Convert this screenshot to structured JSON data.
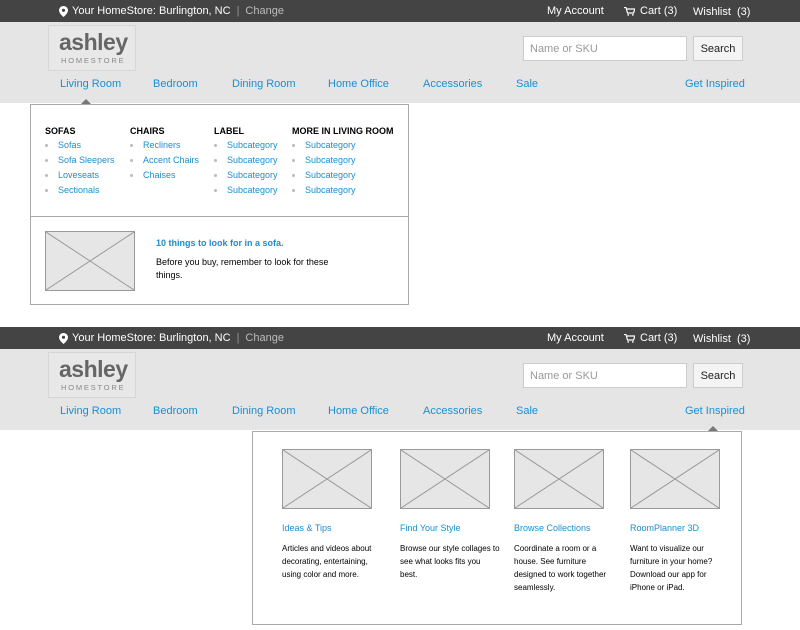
{
  "topbar": {
    "store_label": "Your HomeStore: Burlington, NC",
    "separator": "|",
    "change_label": "Change",
    "my_account": "My Account",
    "cart": "Cart (3)",
    "wishlist": "Wishlist  (3)"
  },
  "logo": {
    "name": "ashley",
    "sub": "HOMESTORE"
  },
  "search": {
    "placeholder": "Name or SKU",
    "button": "Search"
  },
  "nav": {
    "items": [
      "Living Room",
      "Bedroom",
      "Dining Room",
      "Home Office",
      "Accessories",
      "Sale",
      "Get Inspired"
    ]
  },
  "living_room_menu": {
    "columns": [
      {
        "heading": "SOFAS",
        "items": [
          "Sofas",
          "Sofa Sleepers",
          "Loveseats",
          "Sectionals"
        ]
      },
      {
        "heading": "CHAIRS",
        "items": [
          "Recliners",
          "Accent Chairs",
          "Chaises"
        ]
      },
      {
        "heading": "LABEL",
        "items": [
          "Subcategory",
          "Subcategory",
          "Subcategory",
          "Subcategory"
        ]
      },
      {
        "heading": "MORE IN LIVING ROOM",
        "items": [
          "Subcategory",
          "Subcategory",
          "Subcategory",
          "Subcategory"
        ]
      }
    ],
    "feature": {
      "title": "10 things to look for in a sofa.",
      "text": "Before you buy, remember to look for these things."
    }
  },
  "get_inspired_menu": {
    "cards": [
      {
        "title": "Ideas & Tips",
        "text": "Articles and videos about decorating, entertaining, using color and more."
      },
      {
        "title": "Find Your Style",
        "text": "Browse our style collages to see what looks fits you best."
      },
      {
        "title": "Browse Collections",
        "text": "Coordinate a room or a house. See furniture designed to work together seamlessly."
      },
      {
        "title": "RoomPlanner 3D",
        "text": "Want to visualize our furniture in your home? Download our app for iPhone or iPad."
      }
    ]
  },
  "colors": {
    "link": "#1a8fd1",
    "topbar": "#444444",
    "header": "#e5e5e5"
  }
}
